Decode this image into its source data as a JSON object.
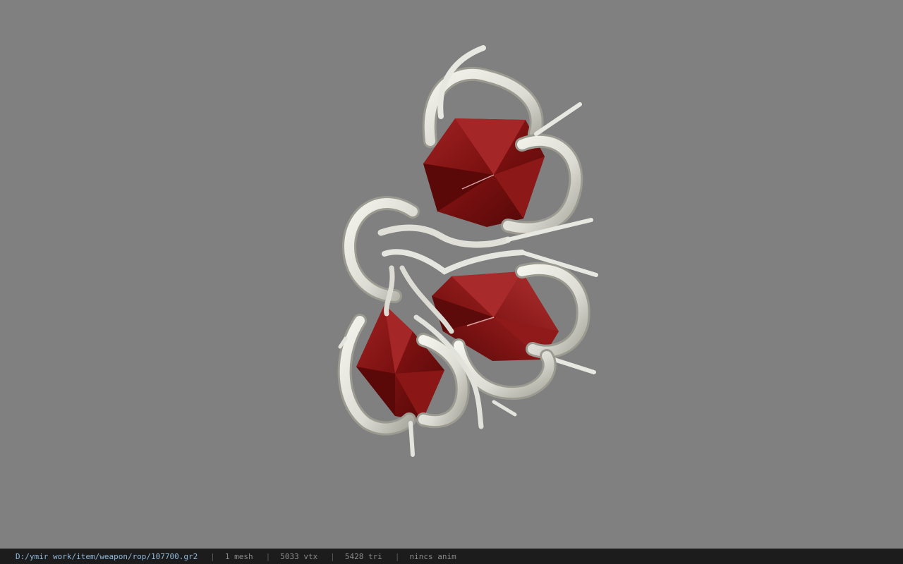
{
  "viewport": {
    "background": "#808080",
    "model_colors": {
      "gem": "#8a1414",
      "gem_shadow": "#4a0606",
      "gem_highlight": "#c04040",
      "frame": "#e4e4de",
      "frame_shadow": "#9a9a90"
    }
  },
  "status": {
    "path": "D:/ymir work/item/weapon/rop/107700.gr2",
    "separator": "|",
    "mesh": "1 mesh",
    "vtx": "5033 vtx",
    "tri": "5428 tri",
    "anim": "nincs anim"
  }
}
